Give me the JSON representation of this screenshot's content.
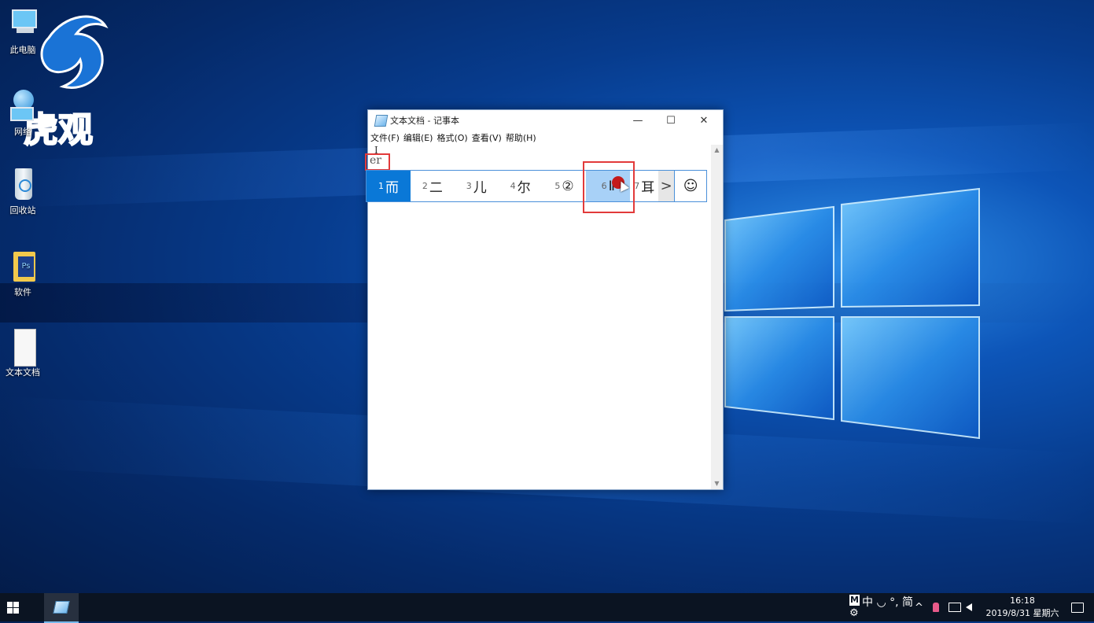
{
  "desktop": {
    "brand_text": "虎观",
    "icons": [
      {
        "label": "此电脑",
        "icon": "computer-icon"
      },
      {
        "label": "网络",
        "icon": "network-icon"
      },
      {
        "label": "回收站",
        "icon": "recycle-bin-icon"
      },
      {
        "label": "软件",
        "icon": "folder-icon"
      },
      {
        "label": "文本文档",
        "icon": "text-file-icon"
      }
    ]
  },
  "notepad": {
    "title": "文本文档 - 记事本",
    "controls": {
      "minimize": "—",
      "maximize": "☐",
      "close": "✕"
    },
    "menu": [
      "文件(F)",
      "编辑(E)",
      "格式(O)",
      "查看(V)",
      "帮助(H)"
    ],
    "caret_glyph": "I",
    "composition": "er"
  },
  "ime": {
    "candidates": [
      {
        "num": "1",
        "text": "而",
        "state": "selected"
      },
      {
        "num": "2",
        "text": "二",
        "state": ""
      },
      {
        "num": "3",
        "text": "儿",
        "state": ""
      },
      {
        "num": "4",
        "text": "尔",
        "state": ""
      },
      {
        "num": "5",
        "text": "②",
        "state": ""
      },
      {
        "num": "6",
        "text": "Ⅱ",
        "state": "hover"
      },
      {
        "num": "7",
        "text": "耳",
        "state": ""
      }
    ],
    "next_glyph": ">",
    "emoji_glyph": "☺"
  },
  "taskbar": {
    "ime_mode_badge": "M",
    "ime_status": "中 ◡ °, 简",
    "ime_settings_glyph": "⚙",
    "tray_chevron": "^",
    "time": "16:18",
    "date": "2019/8/31 星期六",
    "notification_glyph": "🗨"
  }
}
